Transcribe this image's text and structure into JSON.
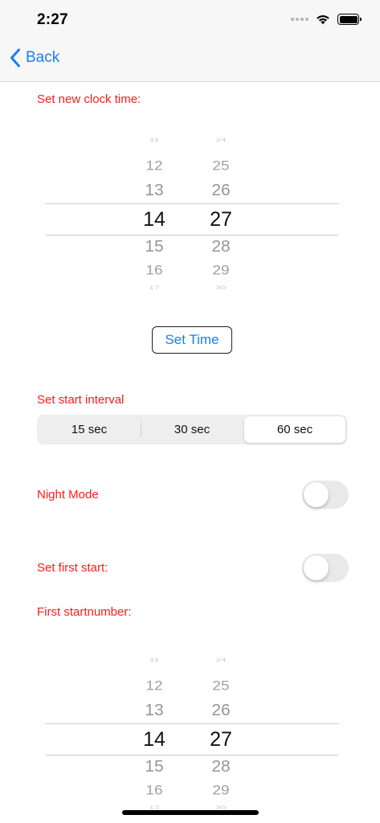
{
  "status_bar": {
    "time": "2:27",
    "icons": [
      "cellular-signal-icon",
      "wifi-icon",
      "battery-icon"
    ]
  },
  "nav": {
    "back_label": "Back",
    "accent_color": "#1a7ff0"
  },
  "clock_section": {
    "label": "Set new clock time:",
    "hours": [
      "11",
      "12",
      "13",
      "14",
      "15",
      "16",
      "17"
    ],
    "minutes": [
      "24",
      "25",
      "26",
      "27",
      "28",
      "29",
      "30"
    ],
    "selected_hour": "14",
    "selected_minute": "27",
    "button_label": "Set Time"
  },
  "interval_section": {
    "label": "Set start interval",
    "options": [
      "15 sec",
      "30 sec",
      "60 sec"
    ],
    "selected": "60 sec"
  },
  "night_mode": {
    "label": "Night Mode",
    "enabled": false
  },
  "first_start": {
    "label": "Set first start:",
    "enabled": false
  },
  "startnumber_section": {
    "label": "First startnumber:",
    "hours": [
      "11",
      "12",
      "13",
      "14",
      "15",
      "16",
      "17"
    ],
    "minutes": [
      "24",
      "25",
      "26",
      "27",
      "28",
      "29",
      "30"
    ],
    "selected_hour": "14",
    "selected_minute": "27"
  },
  "colors": {
    "label_red": "#ff1a1a",
    "toggle_off": "#e9e9ea"
  }
}
